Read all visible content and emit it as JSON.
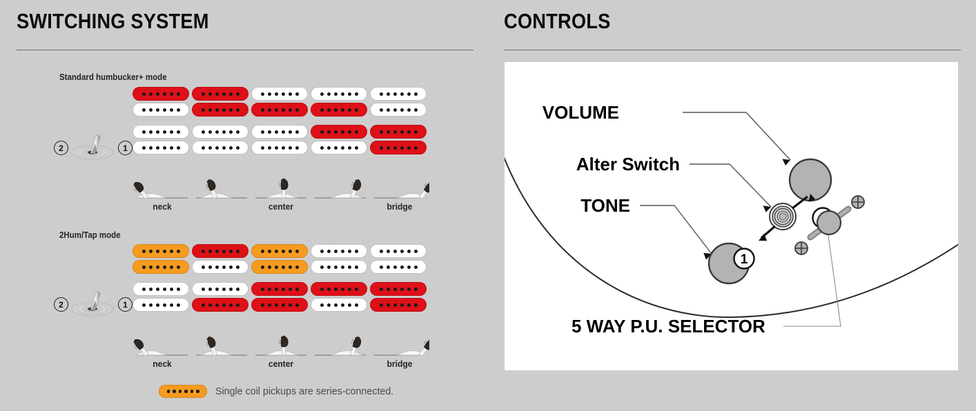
{
  "colors": {
    "background": "#cdcdcd",
    "red": "#de1018",
    "orange": "#f59b20",
    "white": "#ffffff",
    "knob_gray": "#b3b3b3",
    "rule": "#6a6a6a"
  },
  "panels": {
    "switching": {
      "title": "SWITCHING SYSTEM",
      "modes": [
        {
          "label": "Standard humbucker+ mode",
          "lever": {
            "left_number": "2",
            "right_number": "1"
          },
          "position_labels": [
            "neck",
            "",
            "center",
            "",
            "bridge"
          ],
          "columns": [
            {
              "position": 1,
              "coils": [
                "red",
                "white",
                "white",
                "white"
              ]
            },
            {
              "position": 2,
              "coils": [
                "red",
                "red",
                "white",
                "white"
              ]
            },
            {
              "position": 3,
              "coils": [
                "white",
                "red",
                "white",
                "white"
              ]
            },
            {
              "position": 4,
              "coils": [
                "white",
                "red",
                "red",
                "white"
              ]
            },
            {
              "position": 5,
              "coils": [
                "white",
                "white",
                "red",
                "red"
              ]
            }
          ]
        },
        {
          "label": "2Hum/Tap mode",
          "lever": {
            "left_number": "2",
            "right_number": "1"
          },
          "position_labels": [
            "neck",
            "",
            "center",
            "",
            "bridge"
          ],
          "columns": [
            {
              "position": 1,
              "coils": [
                "orange",
                "orange",
                "white",
                "white"
              ]
            },
            {
              "position": 2,
              "coils": [
                "red",
                "white",
                "white",
                "red"
              ]
            },
            {
              "position": 3,
              "coils": [
                "orange",
                "orange",
                "red",
                "red"
              ]
            },
            {
              "position": 4,
              "coils": [
                "white",
                "white",
                "red",
                "white"
              ]
            },
            {
              "position": 5,
              "coils": [
                "white",
                "white",
                "red",
                "red"
              ]
            }
          ]
        }
      ],
      "legend": {
        "chip_color": "orange",
        "text": "Single coil pickups are series-connected."
      }
    },
    "controls": {
      "title": "CONTROLS",
      "labels": {
        "volume": "VOLUME",
        "alter_switch": "Alter Switch",
        "tone": "TONE",
        "selector": "5 WAY P.U. SELECTOR"
      },
      "markers": {
        "one": "1",
        "two": "2"
      }
    }
  }
}
